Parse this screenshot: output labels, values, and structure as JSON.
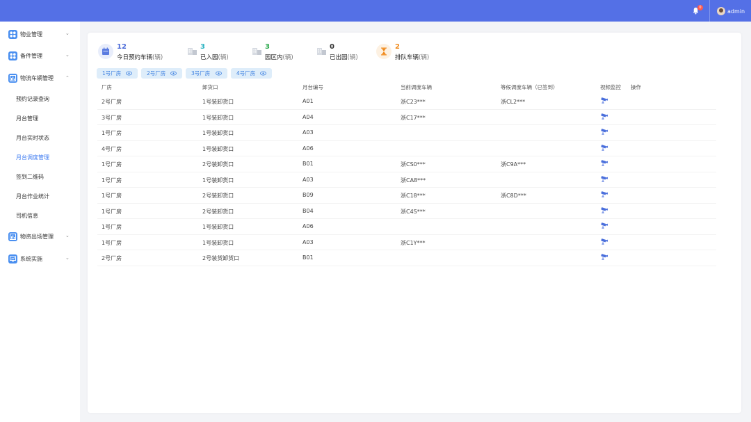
{
  "header": {
    "notification_count": "0",
    "username": "admin"
  },
  "sidebar": {
    "groups": [
      {
        "label": "物业管理",
        "icon": "grid-icon",
        "chevron": "⌄"
      },
      {
        "label": "备件管理",
        "icon": "grid-icon",
        "chevron": "⌄"
      },
      {
        "label": "物流车辆管理",
        "icon": "bar-chart-icon",
        "chevron": "⌃"
      },
      {
        "label": "物资出场管理",
        "icon": "bar-chart-icon",
        "chevron": "⌄"
      },
      {
        "label": "系统实施",
        "icon": "monitor-icon",
        "chevron": "⌄"
      }
    ],
    "sub_items": [
      "预约记录查询",
      "月台管理",
      "月台实时状态",
      "月台调度管理",
      "签到二维码",
      "月台作业统计",
      "司机信息"
    ],
    "active_sub_item": "月台调度管理"
  },
  "stats": [
    {
      "value": "12",
      "label": "今日预约车辆",
      "unit": "(辆)",
      "color": "#4a6ad8"
    },
    {
      "value": "3",
      "label": "已入园",
      "unit": "(辆)",
      "color": "#2bb3c2"
    },
    {
      "value": "3",
      "label": "园区内",
      "unit": "(辆)",
      "color": "#29a84a"
    },
    {
      "value": "0",
      "label": "已出园",
      "unit": "(辆)",
      "color": "#333333"
    },
    {
      "value": "2",
      "label": "排队车辆",
      "unit": "(辆)",
      "color": "#f08a1c"
    }
  ],
  "factory_tabs": [
    "1号厂房",
    "2号厂房",
    "3号厂房",
    "4号厂房"
  ],
  "table": {
    "columns": [
      "厂房",
      "卸货口",
      "月台编号",
      "当前调度车辆",
      "等候调度车辆（已签到）",
      "视频监控",
      "操作"
    ],
    "rows": [
      [
        "2号厂房",
        "1号装卸货口",
        "A01",
        "浙C23***",
        "浙CL2***"
      ],
      [
        "3号厂房",
        "1号装卸货口",
        "A04",
        "浙C17***",
        ""
      ],
      [
        "1号厂房",
        "1号装卸货口",
        "A03",
        "",
        ""
      ],
      [
        "4号厂房",
        "1号装卸货口",
        "A06",
        "",
        ""
      ],
      [
        "1号厂房",
        "2号装卸货口",
        "B01",
        "浙CS0***",
        "浙C9A***"
      ],
      [
        "1号厂房",
        "1号装卸货口",
        "A03",
        "浙CA8***",
        ""
      ],
      [
        "1号厂房",
        "2号装卸货口",
        "B09",
        "浙C18***",
        "浙C8D***"
      ],
      [
        "1号厂房",
        "2号装卸货口",
        "B04",
        "浙C4S***",
        ""
      ],
      [
        "1号厂房",
        "1号装卸货口",
        "A06",
        "",
        ""
      ],
      [
        "1号厂房",
        "1号装卸货口",
        "A03",
        "浙C1Y***",
        ""
      ],
      [
        "2号厂房",
        "2号装货卸货口",
        "B01",
        "",
        ""
      ]
    ]
  },
  "colors": {
    "header": "#5470e6",
    "accent": "#3e7bf1",
    "chip_bg": "#deedfa"
  }
}
